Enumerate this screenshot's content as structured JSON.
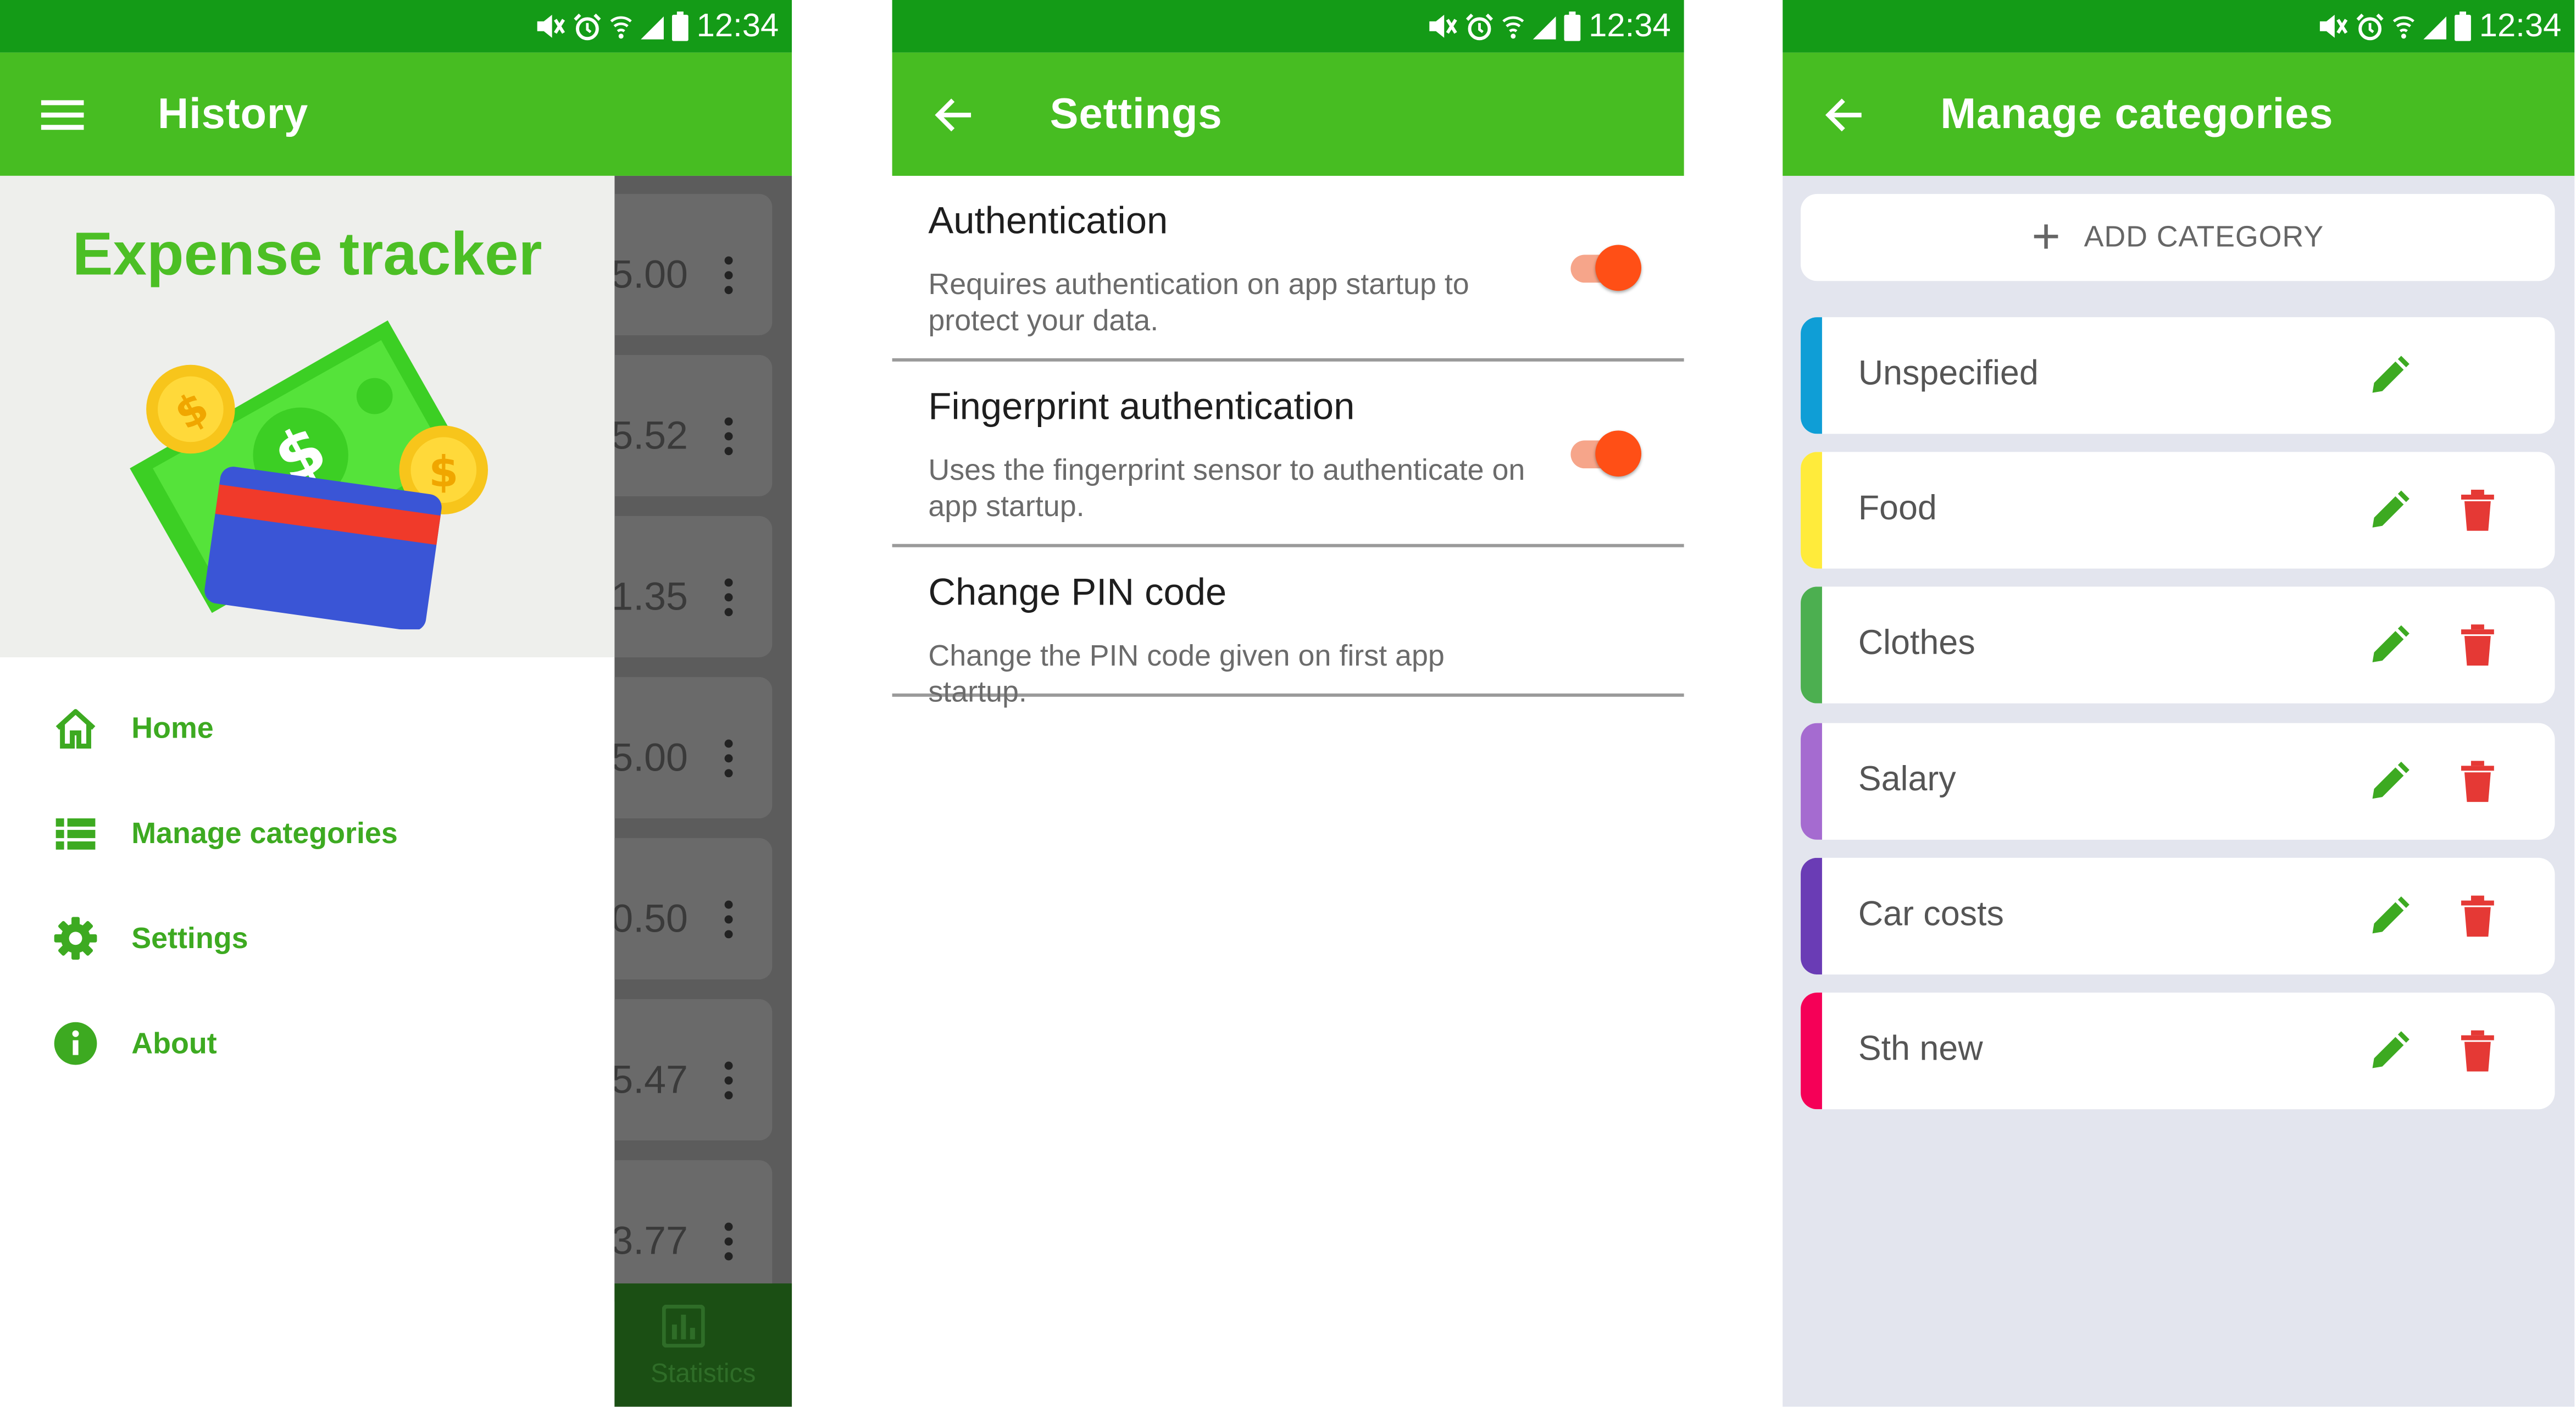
{
  "status_bar": {
    "time": "12:34"
  },
  "screen1": {
    "appbar_title": "History",
    "drawer_brand": "Expense tracker",
    "menu": [
      {
        "label": "Home",
        "icon": "home-icon"
      },
      {
        "label": "Manage categories",
        "icon": "list-icon"
      },
      {
        "label": "Settings",
        "icon": "gear-icon"
      },
      {
        "label": "About",
        "icon": "info-icon"
      }
    ],
    "history_amounts": [
      "5.00",
      "5.52",
      "1.35",
      "5.00",
      "0.50",
      "5.47",
      "3.77"
    ],
    "bottom_nav_label": "Statistics"
  },
  "screen2": {
    "appbar_title": "Settings",
    "prefs": [
      {
        "title": "Authentication",
        "summary": "Requires authentication on app startup to protect your data.",
        "enabled": true
      },
      {
        "title": "Fingerprint authentication",
        "summary": "Uses the fingerprint sensor to authenticate on app startup.",
        "enabled": true
      },
      {
        "title": "Change PIN code",
        "summary": "Change the PIN code given on first app startup."
      }
    ]
  },
  "screen3": {
    "appbar_title": "Manage categories",
    "add_label": "ADD CATEGORY",
    "categories": [
      {
        "name": "Unspecified",
        "color": "#0f9ed6",
        "deletable": false
      },
      {
        "name": "Food",
        "color": "#ffeb3b",
        "deletable": true
      },
      {
        "name": "Clothes",
        "color": "#4caf50",
        "deletable": true
      },
      {
        "name": "Salary",
        "color": "#a56bd0",
        "deletable": true
      },
      {
        "name": "Car costs",
        "color": "#6a3cb5",
        "deletable": true
      },
      {
        "name": "Sth new",
        "color": "#f50057",
        "deletable": true
      }
    ]
  },
  "colors": {
    "status_bar": "#149b17",
    "app_bar": "#47bd22",
    "accent_green": "#4cbf25",
    "switch_on": "#ff4f16",
    "delete_red": "#e53935"
  }
}
